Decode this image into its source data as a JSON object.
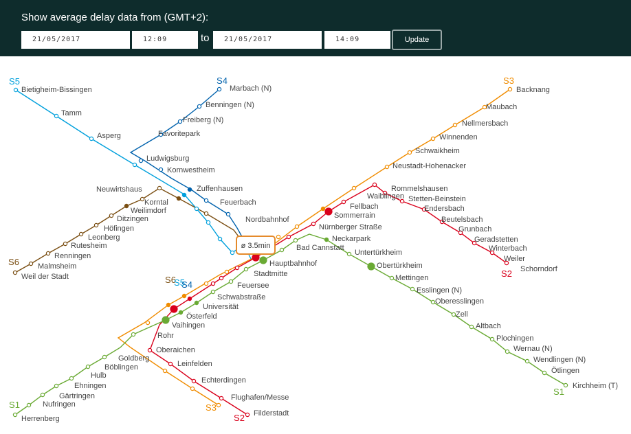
{
  "header": {
    "title": "Show average delay data from (GMT+2):",
    "from_date": "21/05/2017",
    "from_time": "12:09",
    "to_label": "to",
    "to_date": "21/05/2017",
    "to_time": "14:09",
    "update_label": "Update"
  },
  "map": {
    "delay_label": "ø 3.5min",
    "colors": {
      "S1": "#6aaa34",
      "S2": "#d9001b",
      "S3": "#f08c00",
      "S4": "#0062ad",
      "S5": "#00a0dc",
      "S6": "#7a4e12",
      "header": "#0e2c2c",
      "delay_box": "#e58a2b"
    },
    "line_names": {
      "S1a": "S1",
      "S1b": "S1",
      "S2a": "S2",
      "S2b": "S2",
      "S3a": "S3",
      "S3b": "S3",
      "S4": "S4",
      "S4b": "S4",
      "S5": "S5",
      "S5b": "S5",
      "S6": "S6",
      "S6b": "S6"
    },
    "stations": {
      "bietigheim": "Bietigheim-Bissingen",
      "tamm": "Tamm",
      "asperg": "Asperg",
      "marbach": "Marbach (N)",
      "benningen": "Benningen (N)",
      "freiberg": "Freiberg (N)",
      "favoritepark": "Favoritepark",
      "ludwigsburg": "Ludwigsburg",
      "kornwestheim": "Kornwestheim",
      "zuffenhausen": "Zuffenhausen",
      "feuerbach": "Feuerbach",
      "nordbahnhof": "Nordbahnhof",
      "neuwirtshaus": "Neuwirtshaus",
      "korntal": "Korntal",
      "weilimdorf": "Weilimdorf",
      "ditzingen": "Ditzingen",
      "hoefingen": "Höfingen",
      "leonberg": "Leonberg",
      "rutesheim": "Rutesheim",
      "renningen": "Renningen",
      "malmsheim": "Malmsheim",
      "weil": "Weil der Stadt",
      "backnang": "Backnang",
      "maubach": "Maubach",
      "nellmersbach": "Nellmersbach",
      "winnenden": "Winnenden",
      "schwaikheim": "Schwaikheim",
      "neustadt": "Neustadt-Hohenacker",
      "rommelshausen": "Rommelshausen",
      "waiblingen": "Waiblingen",
      "stetten": "Stetten-Beinstein",
      "endersbach": "Endersbach",
      "beutelsbach": "Beutelsbach",
      "grunbach": "Grunbach",
      "geradstetten": "Geradstetten",
      "winterbach": "Winterbach",
      "weiler": "Weiler",
      "schorndorf": "Schorndorf",
      "fellbach": "Fellbach",
      "sommerrain": "Sommerrain",
      "nuernberger": "Nürnberger Straße",
      "neckarpark": "Neckarpark",
      "badcannstatt": "Bad Cannstatt",
      "untertuerkheim": "Untertürkheim",
      "obertuerkheim": "Obertürkheim",
      "mettingen": "Mettingen",
      "esslingen": "Esslingen (N)",
      "oberesslingen": "Oberesslingen",
      "zell": "Zell",
      "altbach": "Altbach",
      "plochingen": "Plochingen",
      "wernau": "Wernau (N)",
      "wendlingen": "Wendlingen (N)",
      "oetlingen": "Ötlingen",
      "kirchheim": "Kirchheim (T)",
      "hauptbahnhof": "Hauptbahnhof",
      "stadtmitte": "Stadtmitte",
      "feuersee": "Feuersee",
      "schwabstrasse": "Schwabstraße",
      "universitaet": "Universität",
      "oesterfeld": "Österfeld",
      "vaihingen": "Vaihingen",
      "rohr": "Rohr",
      "oberaichen": "Oberaichen",
      "leinfelden": "Leinfelden",
      "echterdingen": "Echterdingen",
      "flughafen": "Flughafen/Messe",
      "filderstadt": "Filderstadt",
      "goldberg": "Goldberg",
      "boeblingen": "Böblingen",
      "hulb": "Hulb",
      "ehningen": "Ehningen",
      "gaertringen": "Gärtringen",
      "nufringen": "Nufringen",
      "herrenberg": "Herrenberg"
    }
  }
}
